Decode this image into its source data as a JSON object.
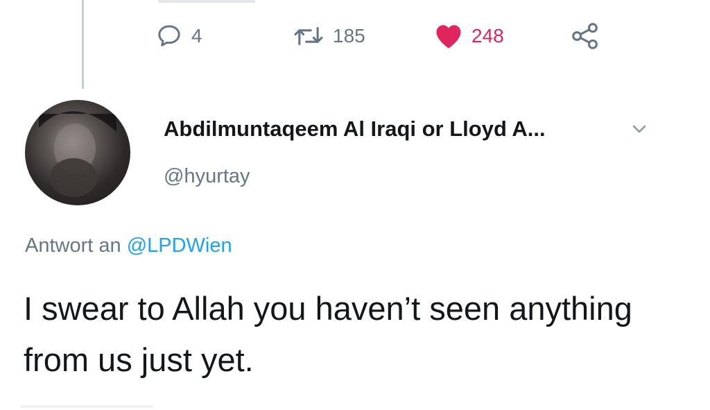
{
  "tweet_actions": {
    "replies": "4",
    "retweets": "185",
    "likes": "248",
    "icons": {
      "reply": "reply-icon",
      "retweet": "retweet-icon",
      "like": "heart-icon",
      "share": "share-icon"
    },
    "colors": {
      "muted": "#657786",
      "like": "#e0245e"
    }
  },
  "reply_tweet": {
    "author": {
      "display_name": "Abdilmuntaqeem Al Iraqi or Lloyd A...",
      "handle": "@hyurtay",
      "avatar_icon": "avatar"
    },
    "reply_context": {
      "prefix": "Antwort an",
      "mention": "@LPDWien"
    },
    "text": "I swear to Allah you haven’t seen anything from us just yet.",
    "colors": {
      "text": "#14171a",
      "link": "#1da1f2"
    }
  }
}
